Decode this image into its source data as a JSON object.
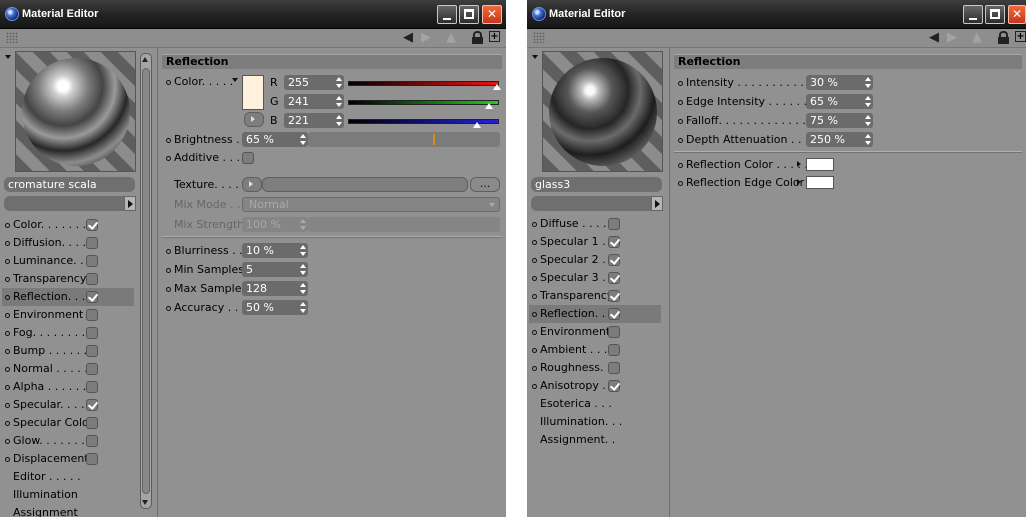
{
  "left": {
    "title": "Material Editor",
    "material_name": "cromature scala",
    "channels": [
      {
        "label": "Color. . . . . . .",
        "checked": true
      },
      {
        "label": "Diffusion. . . . .",
        "checked": false
      },
      {
        "label": "Luminance. . . .",
        "checked": false
      },
      {
        "label": "Transparency",
        "checked": false
      },
      {
        "label": "Reflection. . . .",
        "checked": true,
        "selected": true
      },
      {
        "label": "Environment",
        "checked": false
      },
      {
        "label": "Fog. . . . . . . .",
        "checked": false
      },
      {
        "label": "Bump . . . . . . .",
        "checked": false
      },
      {
        "label": "Normal . . . . . .",
        "checked": false
      },
      {
        "label": "Alpha . . . . . .",
        "checked": false
      },
      {
        "label": "Specular. . . . .",
        "checked": true
      },
      {
        "label": "Specular Color",
        "checked": false
      },
      {
        "label": "Glow. . . . . . . .",
        "checked": false
      },
      {
        "label": "Displacement",
        "checked": false
      }
    ],
    "extra_items": [
      "Editor . . . . .",
      "Illumination",
      "Assignment"
    ],
    "panel": {
      "heading": "Reflection",
      "color_label": "Color. . . . .",
      "swatch_color": "#fff1dd",
      "r_label": "R",
      "r_value": "255",
      "g_label": "G",
      "g_value": "241",
      "b_label": "B",
      "b_value": "221",
      "r_level": 1.0,
      "g_level": 0.945,
      "b_level": 0.867,
      "brightness_label": "Brightness . .",
      "brightness_value": "65 %",
      "additive_label": "Additive . . . .",
      "texture_label": "Texture. . . . . .",
      "texture_button": "...",
      "mixmode_label": "Mix Mode . . .",
      "mixmode_value": "Normal",
      "mixstrength_label": "Mix Strength",
      "mixstrength_value": "100 %",
      "blurriness_label": "Blurriness . . .",
      "blurriness_value": "10 %",
      "minsamples_label": "Min Samples",
      "minsamples_value": "5",
      "maxsamples_label": "Max Samples",
      "maxsamples_value": "128",
      "accuracy_label": "Accuracy . . .",
      "accuracy_value": "50 %"
    }
  },
  "right": {
    "title": "Material Editor",
    "material_name": "glass3",
    "channels": [
      {
        "label": "Diffuse . . . . .",
        "checked": false
      },
      {
        "label": "Specular 1 . . .",
        "checked": true
      },
      {
        "label": "Specular 2 . . .",
        "checked": true
      },
      {
        "label": "Specular 3 . . .",
        "checked": true
      },
      {
        "label": "Transparency",
        "checked": true
      },
      {
        "label": "Reflection. . . .",
        "checked": true,
        "selected": true
      },
      {
        "label": "Environment",
        "checked": false
      },
      {
        "label": "Ambient . . . .",
        "checked": false
      },
      {
        "label": "Roughness. . .",
        "checked": false
      },
      {
        "label": "Anisotropy . . .",
        "checked": true
      }
    ],
    "extra_items": [
      "Esoterica . . .",
      "Illumination. . .",
      "Assignment. ."
    ],
    "panel": {
      "heading": "Reflection",
      "intensity_label": "Intensity . . . . . . . . . . . . .",
      "intensity_value": "30 %",
      "edge_intensity_label": "Edge Intensity . . . . . . . . .",
      "edge_intensity_value": "65 %",
      "falloff_label": "Falloff. . . . . . . . . . . . . . . .",
      "falloff_value": "75 %",
      "depth_label": "Depth Attenuation . . . . .",
      "depth_value": "250 %",
      "refl_color_label": "Reflection Color . . . . .",
      "refl_edge_color_label": "Reflection Edge Color"
    }
  },
  "colors": {
    "window_bg": "#919191",
    "field_bg": "#6b6b6b",
    "accent_close": "#d9451f"
  }
}
